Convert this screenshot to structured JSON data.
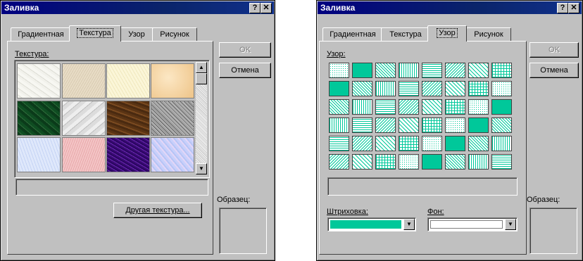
{
  "left_dialog": {
    "title": "Заливка",
    "help_btn": "?",
    "close_btn": "✕",
    "tabs": [
      "Градиентная",
      "Текстура",
      "Узор",
      "Рисунок"
    ],
    "section_label": "Текстура:",
    "ok_label": "OK",
    "cancel_label": "Отмена",
    "sample_label": "Образец:",
    "other_texture_label": "Другая текстура..."
  },
  "right_dialog": {
    "title": "Заливка",
    "help_btn": "?",
    "close_btn": "✕",
    "tabs": [
      "Градиентная",
      "Текстура",
      "Узор",
      "Рисунок"
    ],
    "section_label": "Узор:",
    "ok_label": "OK",
    "cancel_label": "Отмена",
    "sample_label": "Образец:",
    "hatch_label": "Штриховка:",
    "background_label": "Фон:",
    "hatch_color": "#00c89a",
    "background_color": "#ffffff"
  },
  "textures": [
    "white marble",
    "beige paper",
    "cream paper",
    "peach parchment",
    "green marble",
    "white-gray marble",
    "brown wood",
    "granite",
    "blue tissue",
    "pink tissue",
    "purple mesh",
    "light blue mosaic"
  ],
  "colors": {
    "pattern_fg": "#00c89a",
    "selection": "#000080"
  }
}
